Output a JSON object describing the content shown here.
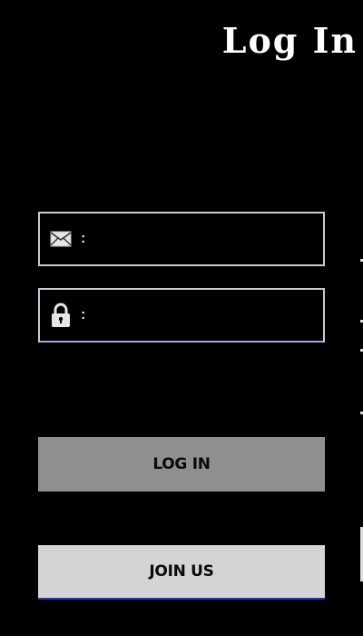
{
  "header": {
    "title": "Log In"
  },
  "form": {
    "email": {
      "icon": "envelope-icon",
      "separator": ":",
      "value": "",
      "placeholder": ""
    },
    "password": {
      "icon": "padlock-icon",
      "separator": ":",
      "value": "",
      "placeholder": ""
    }
  },
  "buttons": {
    "login_label": "LOG IN",
    "join_label": "JOIN US"
  },
  "colors": {
    "background": "#000000",
    "field_border": "#c9c9d4",
    "login_button": "#8f8f8f",
    "join_button": "#d4d4d4",
    "button_text": "#0a0a0a"
  }
}
